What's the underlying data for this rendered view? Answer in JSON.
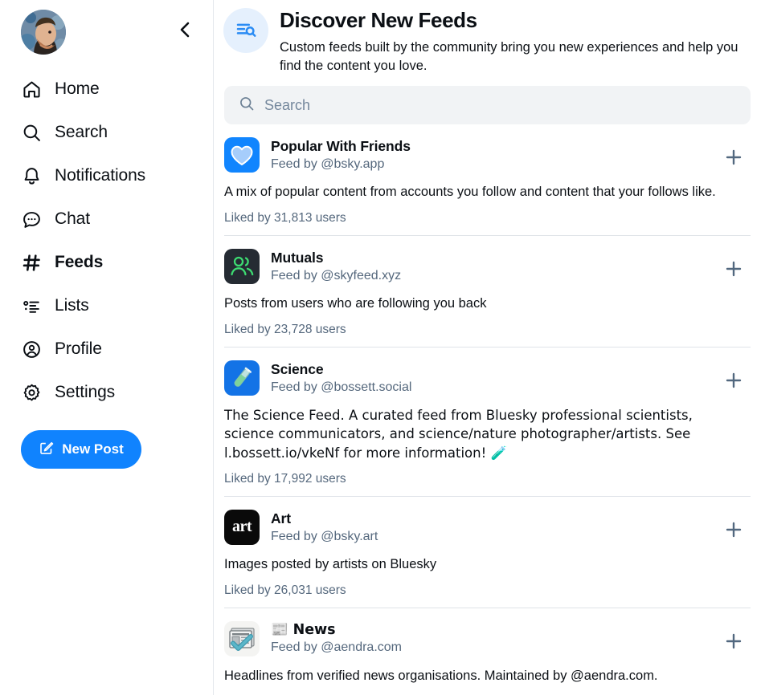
{
  "sidebar": {
    "avatar_name": "user-avatar",
    "collapse_icon": "chevron-left-icon",
    "items": [
      {
        "label": "Home",
        "icon": "home-icon",
        "active": false
      },
      {
        "label": "Search",
        "icon": "search-icon",
        "active": false
      },
      {
        "label": "Notifications",
        "icon": "bell-icon",
        "active": false
      },
      {
        "label": "Chat",
        "icon": "chat-bubble-icon",
        "active": false
      },
      {
        "label": "Feeds",
        "icon": "hashtag-icon",
        "active": true
      },
      {
        "label": "Lists",
        "icon": "list-icon",
        "active": false
      },
      {
        "label": "Profile",
        "icon": "user-circle-icon",
        "active": false
      },
      {
        "label": "Settings",
        "icon": "gear-icon",
        "active": false
      }
    ],
    "new_post": {
      "label": "New Post",
      "icon": "compose-icon",
      "color": "#1083fe"
    }
  },
  "header": {
    "icon": "feed-search-icon",
    "icon_bg": "#e5f0fd",
    "title": "Discover New Feeds",
    "subtitle": "Custom feeds built by the community bring you new experiences and help you find the content you love."
  },
  "search": {
    "icon": "search-icon",
    "placeholder": "Search",
    "value": ""
  },
  "feeds": [
    {
      "name": "Popular With Friends",
      "by": "Feed by @bsky.app",
      "description": "A mix of popular content from accounts you follow and content that your follows like.",
      "likes": "Liked by 31,813 users",
      "avatar": "heart-avatar",
      "avatar_bg": "#1185fe",
      "add_icon": "plus-icon"
    },
    {
      "name": "Mutuals",
      "by": "Feed by @skyfeed.xyz",
      "description": "Posts from users who are following you back",
      "likes": "Liked by 23,728 users",
      "avatar": "two-people-avatar",
      "avatar_bg": "#252b33",
      "add_icon": "plus-icon"
    },
    {
      "name": "Science",
      "by": "Feed by @bossett.social",
      "description": "The Science Feed. A curated feed from Bluesky professional scientists,  science communicators, and science/nature photographer/artists. See l.bossett.io/vkeNf for more information! 🧪",
      "likes": "Liked by 17,992 users",
      "avatar": "test-tube-avatar",
      "avatar_bg": "#1373e6",
      "add_icon": "plus-icon"
    },
    {
      "name": "Art",
      "by": "Feed by @bsky.art",
      "description": "Images posted by artists on Bluesky",
      "likes": "Liked by 26,031 users",
      "avatar": "art-text-avatar",
      "avatar_bg": "#0a0a0a",
      "avatar_text": "art",
      "add_icon": "plus-icon"
    },
    {
      "name": "📰 News",
      "by": "Feed by @aendra.com",
      "description": "Headlines from verified news organisations. Maintained by @aendra.com.",
      "likes": "",
      "avatar": "newspaper-check-avatar",
      "avatar_bg": "#f4f4f2",
      "add_icon": "plus-icon"
    }
  ],
  "colors": {
    "accent": "#1083fe",
    "muted_text": "#55687d",
    "divider": "#dfe3e8",
    "search_bg": "#f1f3f5"
  }
}
